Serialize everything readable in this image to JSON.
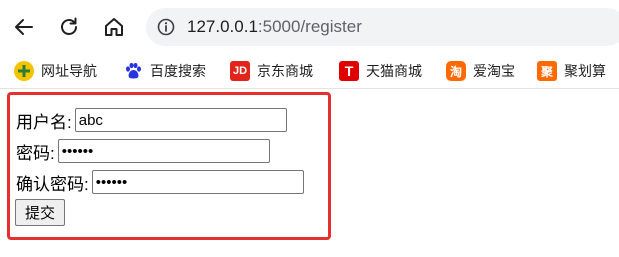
{
  "toolbar": {
    "url_host": "127.0.0.1",
    "url_path": ":5000/register"
  },
  "bookmarks": [
    {
      "label": "网址导航",
      "icon": "hao123-icon",
      "color": "#2e7d32"
    },
    {
      "label": "百度搜索",
      "icon": "baidu-paw-icon",
      "color": "#2932e1"
    },
    {
      "label": "京东商城",
      "icon": "jd-icon",
      "color": "#e1251b",
      "glyph": "JD"
    },
    {
      "label": "天猫商城",
      "icon": "tmall-icon",
      "color": "#e00000",
      "glyph": "T"
    },
    {
      "label": "爱淘宝",
      "icon": "aitaobao-icon",
      "color": "#ff6a00",
      "glyph": "淘"
    },
    {
      "label": "聚划算",
      "icon": "juhuasuan-icon",
      "color": "#ff6a00",
      "glyph": "聚"
    }
  ],
  "form": {
    "username_label": "用户名:",
    "username_value": "abc",
    "password_label": "密码:",
    "password_value": "••••••",
    "confirm_label": "确认密码:",
    "confirm_value": "••••••",
    "submit_label": "提交"
  },
  "colors": {
    "highlight_frame": "#e53030"
  }
}
